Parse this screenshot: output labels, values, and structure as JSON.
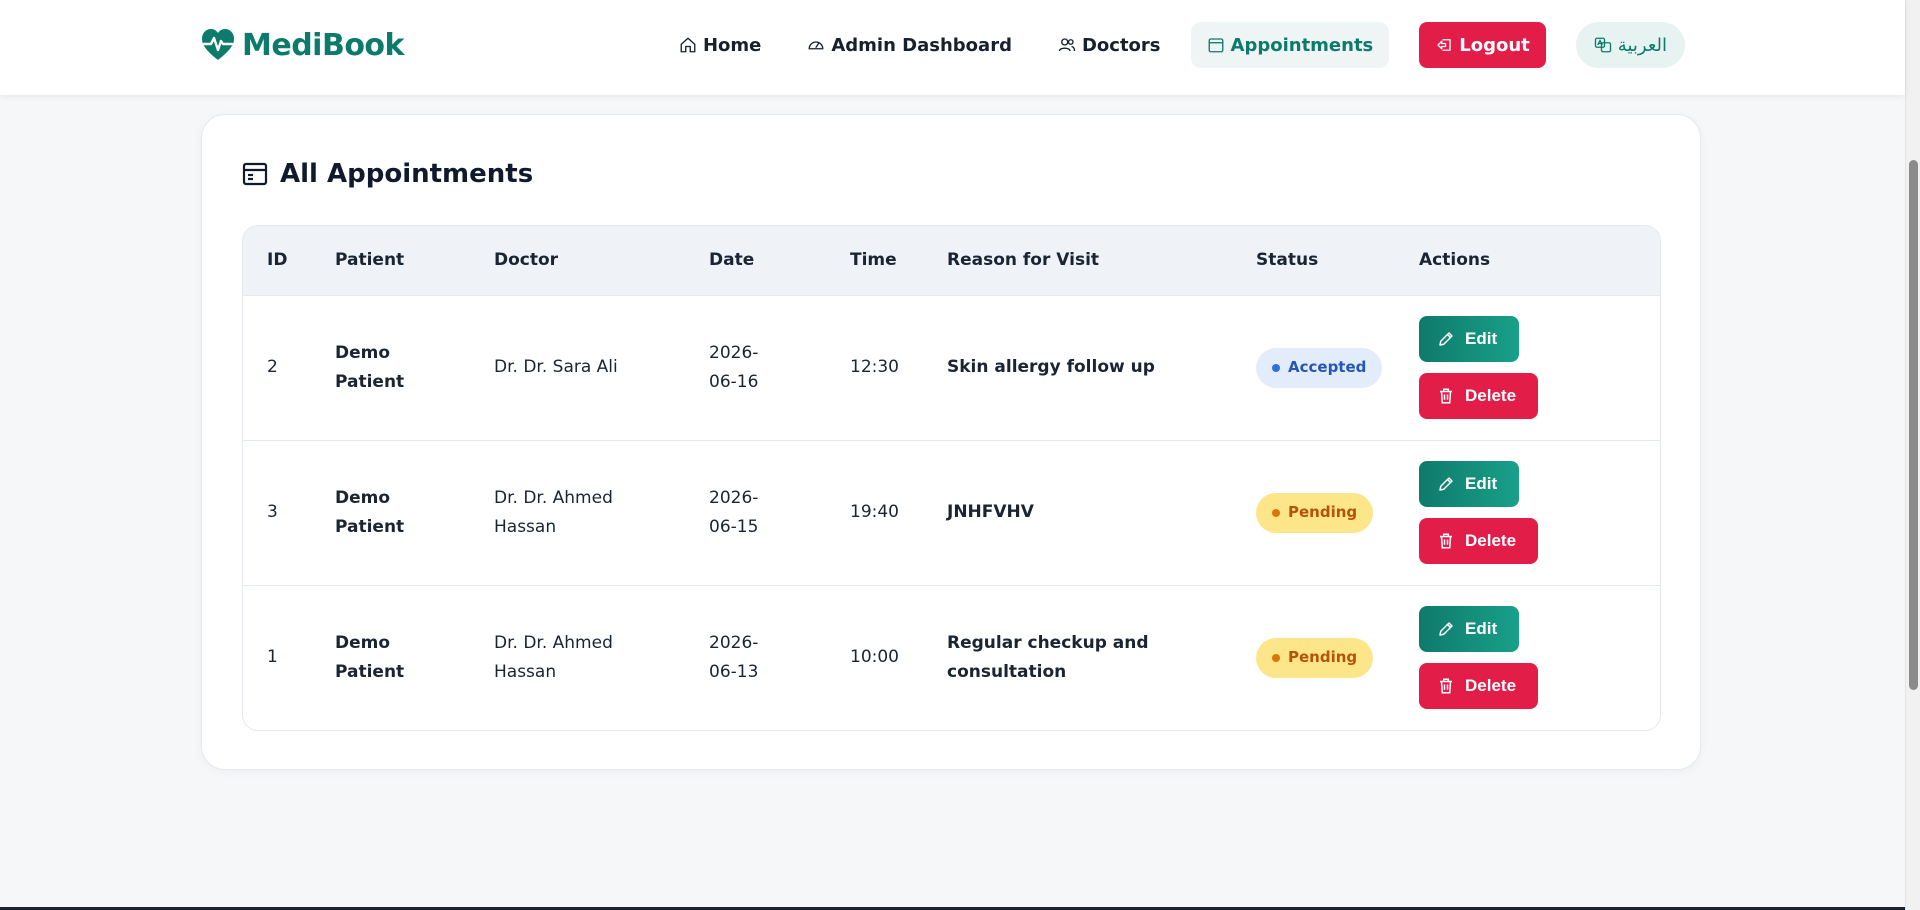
{
  "brand": {
    "name": "MediBook"
  },
  "nav": {
    "home": "Home",
    "admin_dashboard": "Admin Dashboard",
    "doctors": "Doctors",
    "appointments": "Appointments",
    "logout": "Logout",
    "language": "العربية"
  },
  "page": {
    "title": "All Appointments"
  },
  "table": {
    "headers": [
      "ID",
      "Patient",
      "Doctor",
      "Date",
      "Time",
      "Reason for Visit",
      "Status",
      "Actions"
    ],
    "rows": [
      {
        "id": "2",
        "patient": "Demo Patient",
        "doctor": "Dr. Dr. Sara Ali",
        "date": "2026-06-16",
        "time": "12:30",
        "reason": "Skin allergy follow up",
        "status": "Accepted"
      },
      {
        "id": "3",
        "patient": "Demo Patient",
        "doctor": "Dr. Dr. Ahmed Hassan",
        "date": "2026-06-15",
        "time": "19:40",
        "reason": "JNHFVHV",
        "status": "Pending"
      },
      {
        "id": "1",
        "patient": "Demo Patient",
        "doctor": "Dr. Dr. Ahmed Hassan",
        "date": "2026-06-13",
        "time": "10:00",
        "reason": "Regular checkup and consultation",
        "status": "Pending"
      }
    ]
  },
  "actions": {
    "edit": "Edit",
    "delete": "Delete"
  },
  "colors": {
    "brand": "#0c7b6b",
    "danger": "#e11d48",
    "accepted_bg": "#e3ecfb",
    "pending_bg": "#fde68a"
  }
}
